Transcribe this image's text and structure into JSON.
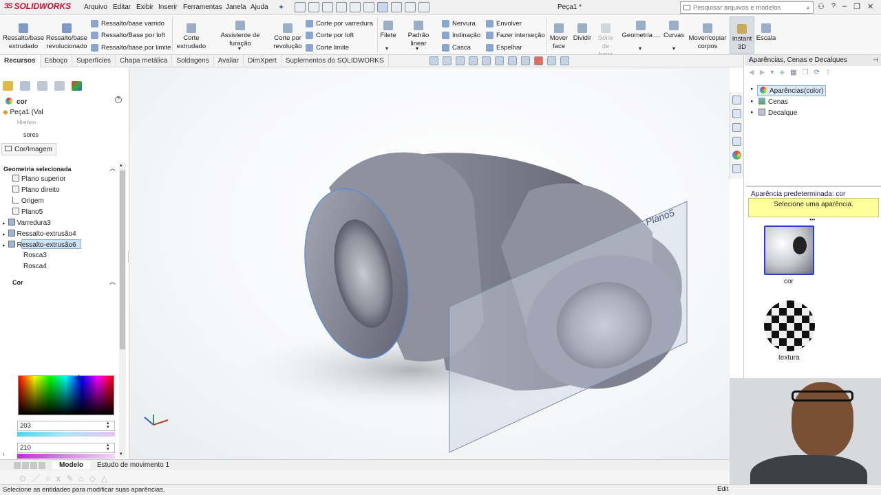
{
  "app": {
    "brand": "SOLIDWORKS",
    "doc_title": "Peça1 *"
  },
  "menu": [
    "Arquivo",
    "Editar",
    "Exibir",
    "Inserir",
    "Ferramentas",
    "Janela",
    "Ajuda"
  ],
  "search": {
    "placeholder": "Pesquisar arquivos e modelos"
  },
  "ribbon": {
    "extrude_boss": "Ressalto/base extrudado",
    "revolve_boss": "Ressalto/base revolucionado",
    "sweep_boss": "Ressalto/base varrido",
    "loft_boss": "Ressalto/Base por loft",
    "boundary_boss": "Ressalto/base por limite",
    "extrude_cut": "Corte extrudado",
    "hole_wizard": "Assistente de furação",
    "revolve_cut": "Corte por revolução",
    "sweep_cut": "Corte por varredura",
    "loft_cut": "Corte por loft",
    "boundary_cut": "Corte limite",
    "fillet": "Filete",
    "linear_pattern": "Padrão linear",
    "rib": "Nervura",
    "draft": "Indinação",
    "shell": "Casca",
    "wrap": "Envolver",
    "intersect": "Fazer interseção",
    "mirror": "Espelhar",
    "move_face": "Mover face",
    "split": "Dividir",
    "surface_series": "Série de furos",
    "geometry": "Geometria ...",
    "curves": "Curvas",
    "move_copy": "Mover/copiar corpos",
    "instant3d": "Instant 3D",
    "scale": "Escala"
  },
  "tabs": [
    "Recursos",
    "Esboço",
    "Superfícies",
    "Chapa metálica",
    "Soldagens",
    "Avaliar",
    "DimXpert",
    "Suplementos do SOLIDWORKS"
  ],
  "left_panel": {
    "pm_title": "cor",
    "part_name": "Peça1  (Val",
    "truncated_1": "... Histório",
    "truncated_2": "sores",
    "subtab": "Cor/Imagem",
    "selected_geometry_header": "Geometria selecionada",
    "tree": [
      "Plano superior",
      "Plano direito",
      "Origem",
      "Plano5",
      "Varredura3",
      "Ressalto-extrusão4",
      "Ressalto-extrusão6",
      "Rosca3",
      "Rosca4"
    ],
    "color_header": "Cor",
    "value1": "203",
    "value2": "210"
  },
  "bottom_tabs": [
    "Modelo",
    "Estudo de movimento 1"
  ],
  "status": "Selecione as entidades para modificar suas aparências.",
  "status_right": "Edit",
  "viewport": {
    "plane_label": "Plano5"
  },
  "right_panel": {
    "title": "Aparências, Cenas e Decalques",
    "tree": [
      "Aparências(color)",
      "Cenas",
      "Decalque"
    ],
    "default_appearance": "Aparência predeterminada: cor",
    "hint": "Selecione uma aparência.",
    "swatch1": "cor",
    "swatch2": "textura"
  }
}
